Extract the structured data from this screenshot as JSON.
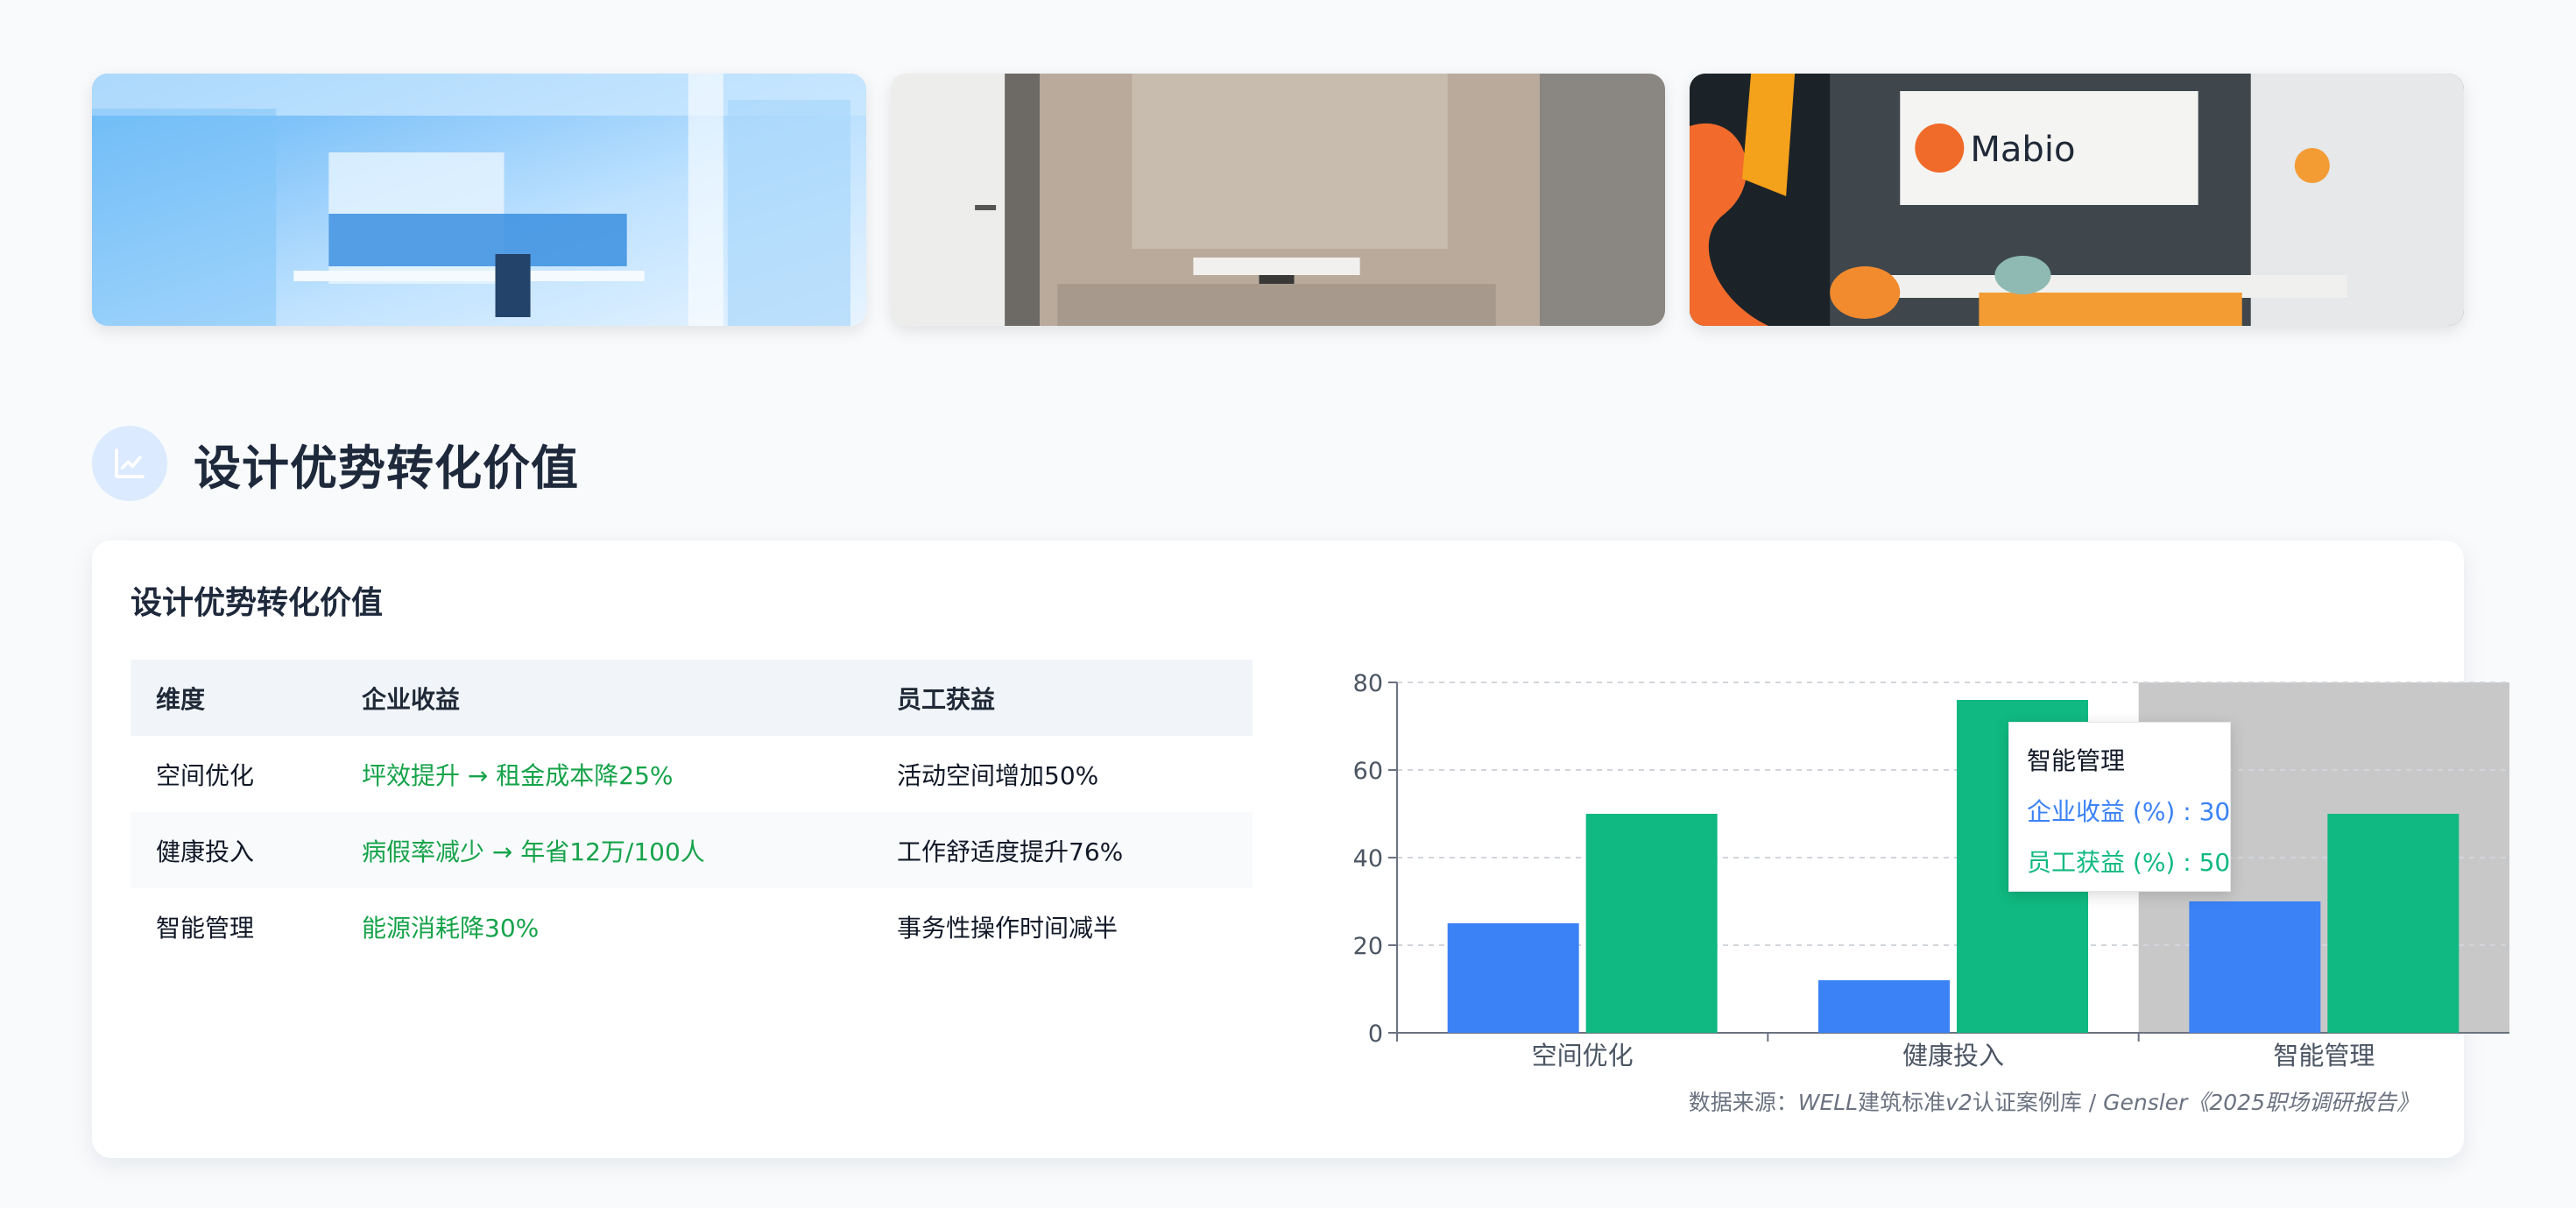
{
  "photos": [
    {
      "name": "office-blue"
    },
    {
      "name": "phone-booth"
    },
    {
      "name": "mabio-lobby",
      "logo_text": "Mabio"
    }
  ],
  "section": {
    "title": "设计优势转化价值",
    "icon": "line-chart-icon"
  },
  "card": {
    "title": "设计优势转化价值",
    "table": {
      "headers": [
        "维度",
        "企业收益",
        "员工获益"
      ],
      "rows": [
        [
          "空间优化",
          "坪效提升 → 租金成本降25%",
          "活动空间增加50%"
        ],
        [
          "健康投入",
          "病假率减少 → 年省12万/100人",
          "工作舒适度提升76%"
        ],
        [
          "智能管理",
          "能源消耗降30%",
          "事务性操作时间减半"
        ]
      ]
    },
    "source": {
      "prefix": "数据来源：",
      "italic1": "WELL",
      "mid": "建筑标准",
      "italic2": "v2",
      "mid2": "认证案例库 / ",
      "italic3": "Gensler",
      "suffix": "《2025职场调研报告》"
    }
  },
  "chart_data": {
    "type": "bar",
    "categories": [
      "空间优化",
      "健康投入",
      "智能管理"
    ],
    "series": [
      {
        "name": "企业收益 (%)",
        "values": [
          25,
          12,
          30
        ],
        "color": "#3b82f6"
      },
      {
        "name": "员工获益 (%)",
        "values": [
          50,
          76,
          50
        ],
        "color": "#10b981"
      }
    ],
    "ylim": [
      0,
      80
    ],
    "yticks": [
      0,
      20,
      40,
      60,
      80
    ],
    "grid": true,
    "highlight_category": "智能管理"
  },
  "tooltip": {
    "title": "智能管理",
    "line1": "企业收益 (%) : 30",
    "line2": "员工获益 (%) : 50"
  }
}
